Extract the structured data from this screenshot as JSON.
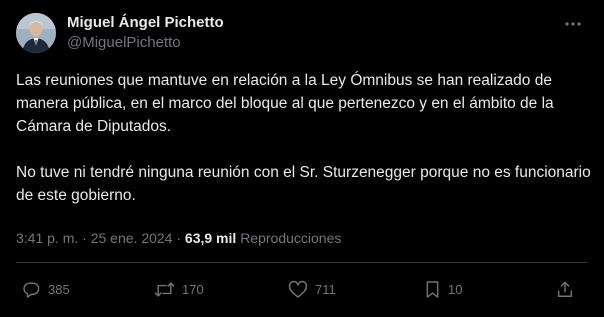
{
  "author": {
    "name": "Miguel Ángel Pichetto",
    "handle": "@MiguelPichetto"
  },
  "post": {
    "paragraphs": [
      "Las reuniones que mantuve en relación a la Ley Ómnibus se han realizado de manera pública, en el marco del bloque al que pertenezco y en el ámbito de la Cámara de Diputados.",
      "No tuve ni tendré ninguna reunión con el Sr. Sturzenegger porque no es funcionario de este gobierno."
    ]
  },
  "meta": {
    "time": "3:41 p. m.",
    "separator": "·",
    "date": "25 ene. 2024",
    "views_count": "63,9 mil",
    "views_label": "Reproducciones"
  },
  "actions": {
    "replies": "385",
    "reposts": "170",
    "likes": "711",
    "bookmarks": "10"
  },
  "colors": {
    "background": "#000000",
    "text_primary": "#e7e9ea",
    "text_secondary": "#71767b",
    "divider": "#2f3336"
  },
  "icons": {
    "more": "more-dots-icon",
    "reply": "reply-bubble-icon",
    "repost": "repost-arrows-icon",
    "like": "heart-icon",
    "bookmark": "bookmark-icon",
    "share": "share-upload-icon"
  }
}
